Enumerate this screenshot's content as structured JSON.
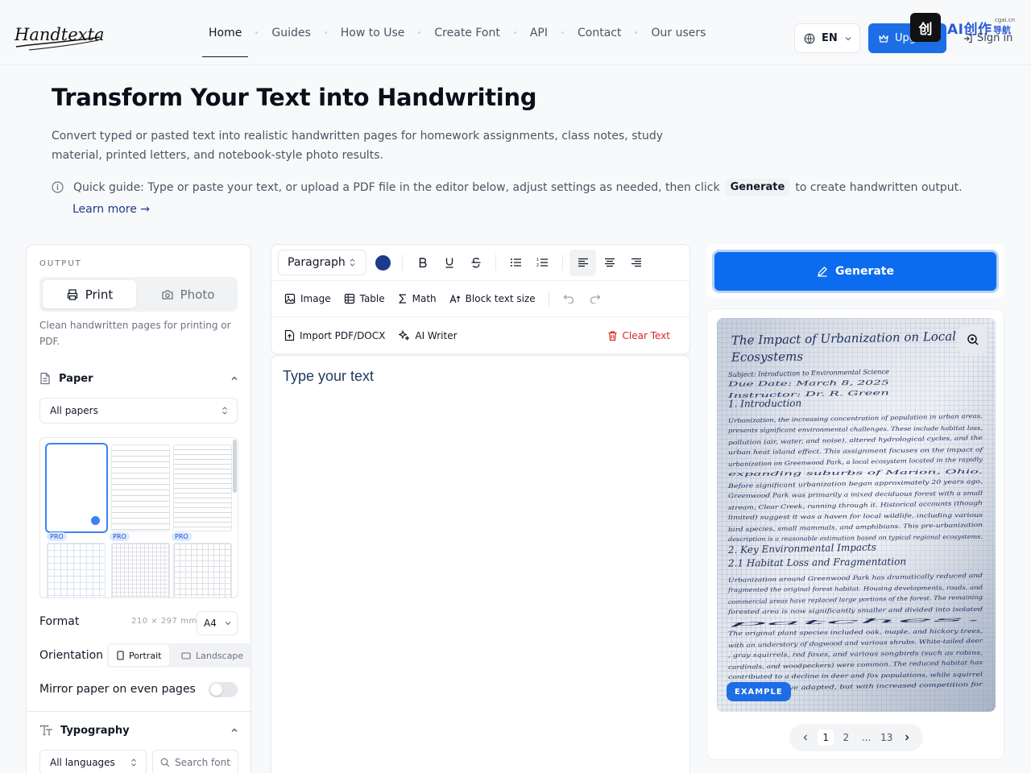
{
  "brand": {
    "logo_text": "Handtextai"
  },
  "nav": {
    "items": [
      {
        "label": "Home",
        "active": true
      },
      {
        "label": "Guides"
      },
      {
        "label": "How to Use"
      },
      {
        "label": "Create Font"
      },
      {
        "label": "API"
      },
      {
        "label": "Contact"
      },
      {
        "label": "Our users"
      }
    ]
  },
  "header": {
    "language": "EN",
    "upgrade_label": "Upgrade",
    "signin_label": "Sign in"
  },
  "watermark": {
    "text": "AI创作",
    "sub": "cgai.cn",
    "sub2": "导航",
    "box": "创"
  },
  "hero": {
    "title": "Transform Your Text into Handwriting",
    "description": "Convert typed or pasted text into realistic handwritten pages for homework assignments, class notes, study material, printed letters, and notebook-style photo results.",
    "guide_before": "Quick guide: Type or paste your text, or upload a PDF file in the editor below, adjust settings as needed, then click",
    "guide_kbd": "Generate",
    "guide_after": "to create handwritten output.",
    "learn_more": "Learn more →"
  },
  "output": {
    "label": "OUTPUT",
    "print_label": "Print",
    "photo_label": "Photo",
    "selected": "Print",
    "description": "Clean handwritten pages for printing or PDF."
  },
  "paper": {
    "title": "Paper",
    "filter": "All papers",
    "pro_badge": "PRO",
    "format_label": "Format",
    "format_dims": "210 × 297 mm",
    "format_value": "A4",
    "orientation_label": "Orientation",
    "portrait_label": "Portrait",
    "landscape_label": "Landscape",
    "mirror_label": "Mirror paper on even pages",
    "mirror_on": false
  },
  "typography": {
    "title": "Typography",
    "languages": "All languages",
    "search_placeholder": "Search fonts"
  },
  "toolbar": {
    "paragraph": "Paragraph",
    "text_color": "#1e3a8a",
    "image": "Image",
    "table": "Table",
    "math": "Math",
    "block_text_size": "Block text size",
    "import": "Import PDF/DOCX",
    "ai_writer": "AI Writer",
    "clear": "Clear Text"
  },
  "editor": {
    "placeholder": "Type your text"
  },
  "generate": {
    "label": "Generate"
  },
  "preview": {
    "badge": "EXAMPLE",
    "pages": [
      "1",
      "2",
      "...",
      "13"
    ],
    "current_page": "1",
    "handwriting": [
      "The Impact of Urbanization on Local",
      "Ecosystems",
      "Subject: Introduction to Environmental Science",
      "Due Date: March 8, 2025",
      "Instructor: Dr. R. Green",
      "1. Introduction",
      "Urbanization, the increasing concentration of population in urban areas,",
      "presents significant environmental challenges. These include habitat loss,",
      "pollution (air, water, and noise), altered hydrological cycles, and the",
      "urban heat island effect. This assignment focuses on the impact of",
      "urbanization on Greenwood Park, a local ecosystem located in the rapidly",
      "expanding suburbs of Marion, Ohio.",
      "Before significant urbanization began approximately 20 years ago,",
      "Greenwood Park was primarily a mixed deciduous forest with a small",
      "stream, Clear Creek, running through it. Historical accounts (though",
      "limited) suggest it was a haven for local wildlife, including various",
      "bird species, small mammals, and amphibians. This pre-urbanization",
      "description is a reasonable estimation based on typical regional ecosystems.",
      "2. Key Environmental Impacts",
      "2.1 Habitat Loss and Fragmentation",
      "Urbanization around Greenwood Park has dramatically reduced and",
      "fragmented the original forest habitat. Housing developments, roads, and",
      "commercial areas have replaced large portions of the forest. The remaining",
      "forested area is now significantly smaller and divided into isolated",
      "patches.",
      "The original plant species included oak, maple, and hickory trees,",
      "with an understory of dogwood and various shrubs. White-tailed deer",
      ", gray squirrels, red foxes, and various songbirds (such as robins,",
      "cardinals, and woodpeckers) were common. The reduced habitat has",
      "contributed to a decline in deer and fox populations, while squirrel",
      "populations have adapted, but with increased competition for"
    ]
  }
}
